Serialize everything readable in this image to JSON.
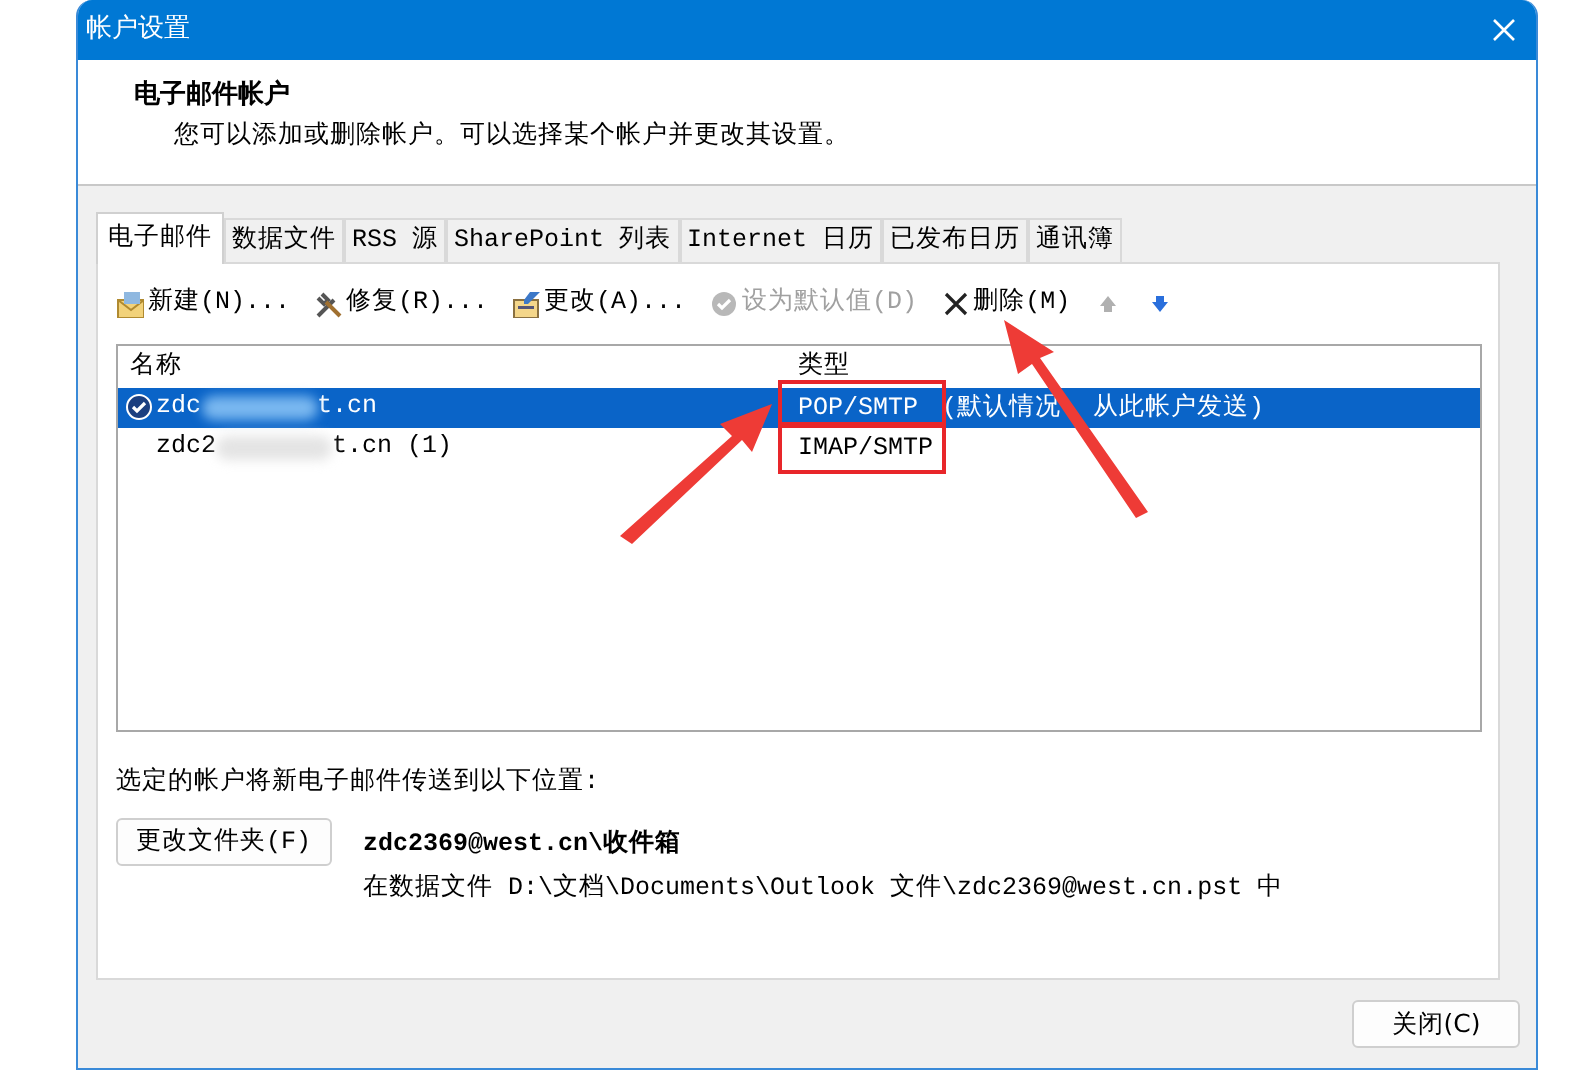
{
  "window": {
    "title": "帐户设置"
  },
  "header": {
    "title": "电子邮件帐户",
    "description": "您可以添加或删除帐户。可以选择某个帐户并更改其设置。"
  },
  "tabs": [
    {
      "label": "电子邮件",
      "selected": true
    },
    {
      "label": "数据文件",
      "selected": false
    },
    {
      "label": "RSS 源",
      "selected": false
    },
    {
      "label": "SharePoint 列表",
      "selected": false
    },
    {
      "label": "Internet 日历",
      "selected": false
    },
    {
      "label": "已发布日历",
      "selected": false
    },
    {
      "label": "通讯簿",
      "selected": false
    }
  ],
  "toolbar": [
    {
      "kind": "new",
      "label": "新建(N)...",
      "disabled": false
    },
    {
      "kind": "repair",
      "label": "修复(R)...",
      "disabled": false
    },
    {
      "kind": "change",
      "label": "更改(A)...",
      "disabled": false
    },
    {
      "kind": "default",
      "label": "设为默认值(D)",
      "disabled": true
    },
    {
      "kind": "delete",
      "label": "删除(M)",
      "disabled": false
    },
    {
      "kind": "up",
      "disabled": true
    },
    {
      "kind": "down",
      "disabled": false
    }
  ],
  "accounts": {
    "columns": [
      "名称",
      "类型"
    ],
    "rows": [
      {
        "name_start": "zdc",
        "name_end": "t.cn",
        "type_parts": [
          "POP/SMTP",
          "(默认情况",
          "从此帐户发送)"
        ],
        "default": true,
        "selected": true
      },
      {
        "name_start": "zdc2",
        "name_end": "t.cn (1)",
        "type_parts": [
          "IMAP/SMTP"
        ],
        "default": false,
        "selected": false
      }
    ]
  },
  "delivery": {
    "label": "选定的帐户将新电子邮件传送到以下位置:",
    "button": "更改文件夹(F)",
    "folder": "zdc2369@west.cn\\收件箱",
    "path": "在数据文件 D:\\文档\\Documents\\Outlook 文件\\zdc2369@west.cn.pst 中"
  },
  "buttons": [
    {
      "label": "关闭(C)"
    }
  ]
}
